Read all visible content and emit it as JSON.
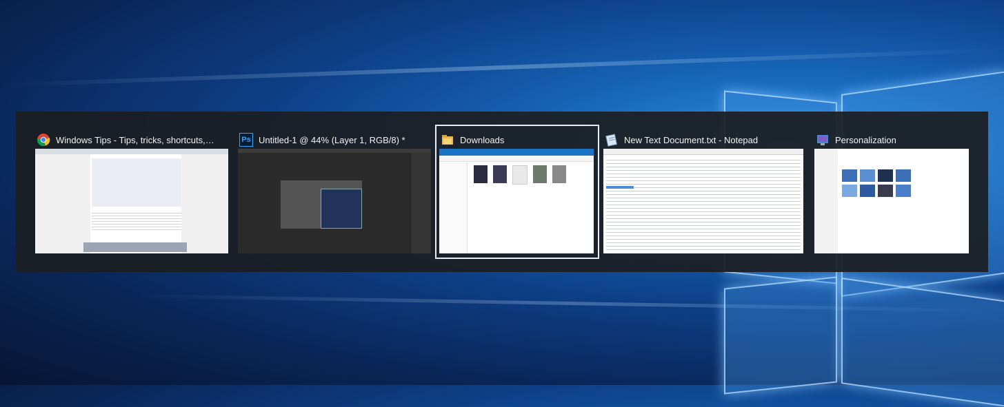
{
  "task_switcher": {
    "windows": [
      {
        "title": "Windows Tips - Tips, tricks, shortcuts, & hac...",
        "icon": "chrome-icon",
        "selected": false
      },
      {
        "title": "Untitled-1 @ 44% (Layer 1, RGB/8) *",
        "icon": "photoshop-icon",
        "icon_text": "Ps",
        "selected": false
      },
      {
        "title": "Downloads",
        "icon": "file-explorer-icon",
        "selected": true
      },
      {
        "title": "New Text Document.txt - Notepad",
        "icon": "notepad-icon",
        "selected": false
      },
      {
        "title": "Personalization",
        "icon": "settings-personalization-icon",
        "selected": false
      }
    ]
  },
  "colors": {
    "switcher_background": "#1c1e21",
    "selected_outline": "#e9eef3",
    "title_text": "#f2f2f2",
    "desktop_blue": "#1766b8"
  }
}
